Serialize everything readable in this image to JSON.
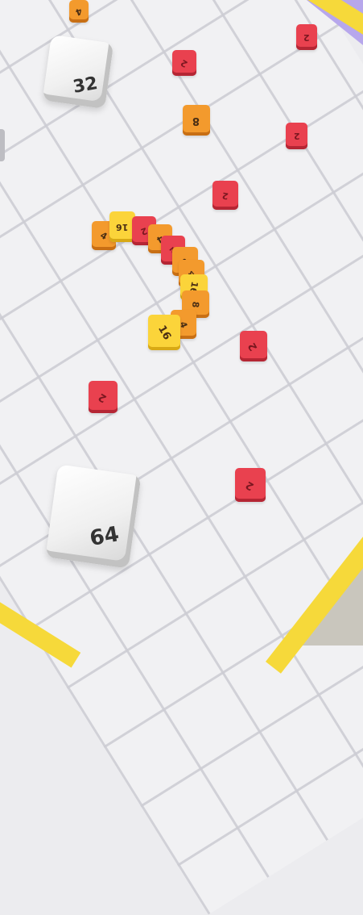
{
  "game": {
    "snake_cubes": [
      {
        "value": "16"
      },
      {
        "value": "4"
      },
      {
        "value": "8"
      },
      {
        "value": "16"
      },
      {
        "value": "4"
      },
      {
        "value": "8"
      },
      {
        "value": "2"
      },
      {
        "value": "4"
      },
      {
        "value": "2"
      },
      {
        "value": "16"
      },
      {
        "value": "4"
      }
    ],
    "loose_cubes": [
      {
        "value": "4"
      },
      {
        "value": "2"
      },
      {
        "value": "2"
      },
      {
        "value": "8"
      },
      {
        "value": "2"
      },
      {
        "value": "2"
      },
      {
        "value": "2"
      },
      {
        "value": "2"
      },
      {
        "value": "2"
      }
    ],
    "big_cubes": [
      {
        "value": "32"
      },
      {
        "value": "64"
      }
    ]
  }
}
